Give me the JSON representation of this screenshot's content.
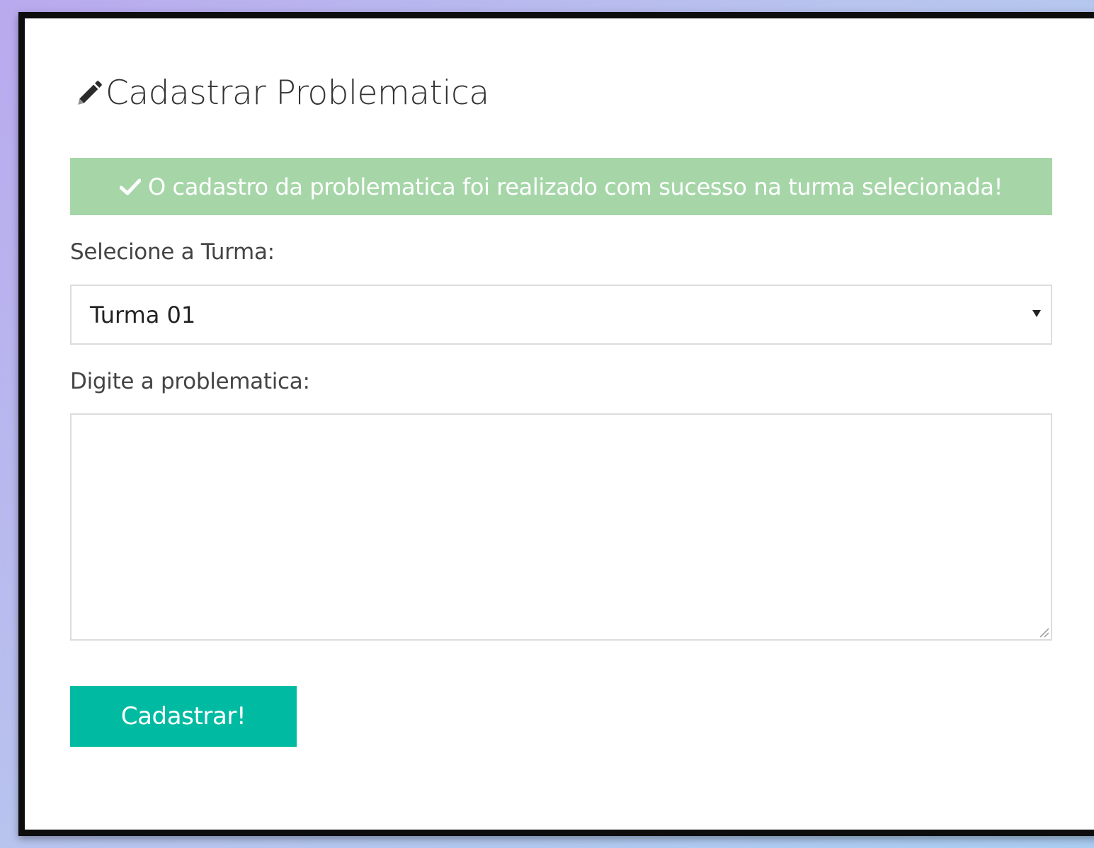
{
  "form": {
    "title": "Cadastrar Problematica",
    "title_icon": "pencil-icon",
    "success_alert": {
      "icon": "check-icon",
      "message": "O cadastro da problematica foi realizado com sucesso na turma selecionada!",
      "background_color": "#a6d6a8"
    },
    "turma_label": "Selecione a Turma:",
    "turma_select": {
      "selected_value": "Turma 01",
      "icon": "caret-down-icon"
    },
    "problematica_label": "Digite a problematica:",
    "problematica_textarea": {
      "value": ""
    },
    "submit_button": {
      "label": "Cadastrar!",
      "color": "#00bba2"
    }
  }
}
